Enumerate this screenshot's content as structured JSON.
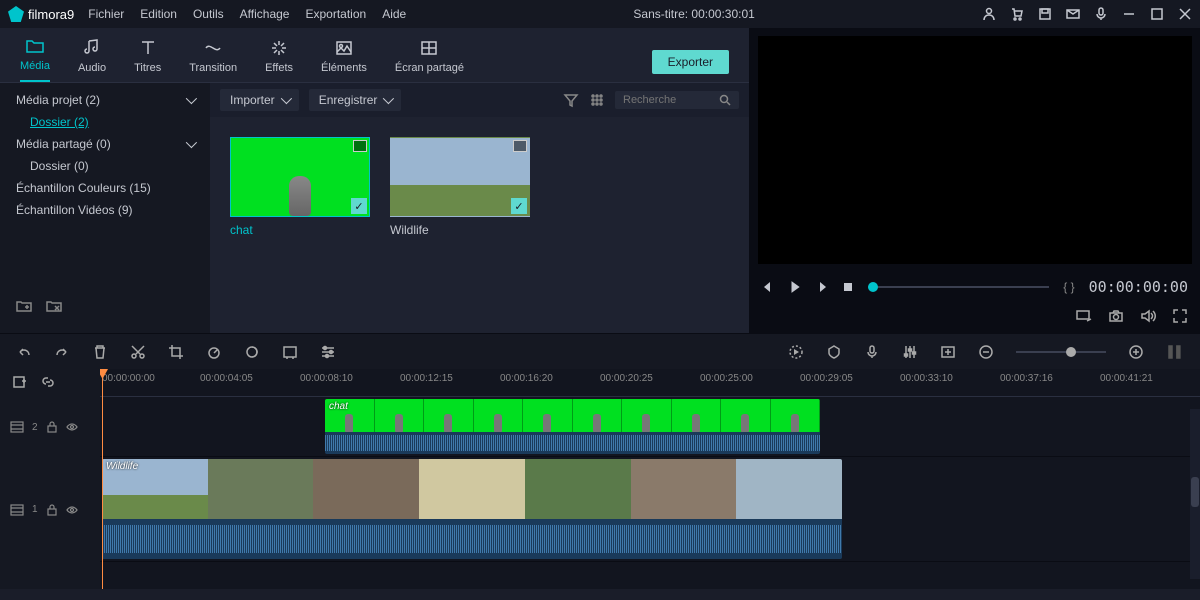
{
  "app": {
    "name": "filmora9",
    "title": "Sans-titre:  00:00:30:01"
  },
  "menu": [
    "Fichier",
    "Edition",
    "Outils",
    "Affichage",
    "Exportation",
    "Aide"
  ],
  "tabs": [
    {
      "label": "Média",
      "icon": "folder",
      "active": true
    },
    {
      "label": "Audio",
      "icon": "music"
    },
    {
      "label": "Titres",
      "icon": "text"
    },
    {
      "label": "Transition",
      "icon": "transition"
    },
    {
      "label": "Effets",
      "icon": "sparkle"
    },
    {
      "label": "Éléments",
      "icon": "image"
    },
    {
      "label": "Écran partagé",
      "icon": "split"
    }
  ],
  "export_label": "Exporter",
  "tree": {
    "items": [
      {
        "label": "Média projet (2)",
        "expandable": true
      },
      {
        "label": "Dossier (2)",
        "sub": true,
        "selected": true
      },
      {
        "label": "Média partagé (0)",
        "expandable": true
      },
      {
        "label": "Dossier (0)",
        "sub": true
      },
      {
        "label": "Échantillon Couleurs (15)"
      },
      {
        "label": "Échantillon Vidéos (9)"
      }
    ]
  },
  "media_toolbar": {
    "import": "Importer",
    "record": "Enregistrer",
    "search_placeholder": "Recherche"
  },
  "thumbs": [
    {
      "label": "chat",
      "type": "green",
      "selected": true
    },
    {
      "label": "Wildlife",
      "type": "wild"
    }
  ],
  "preview": {
    "timecode": "00:00:00:00",
    "braces": "{  }"
  },
  "ruler": [
    "00:00:00:00",
    "00:00:04:05",
    "00:00:08:10",
    "00:00:12:15",
    "00:00:16:20",
    "00:00:20:25",
    "00:00:25:00",
    "00:00:29:05",
    "00:00:33:10",
    "00:00:37:16",
    "00:00:41:21"
  ],
  "tracks": {
    "t2": {
      "num": "2",
      "clip": "chat"
    },
    "t1": {
      "num": "1",
      "clip": "Wildlife"
    }
  }
}
